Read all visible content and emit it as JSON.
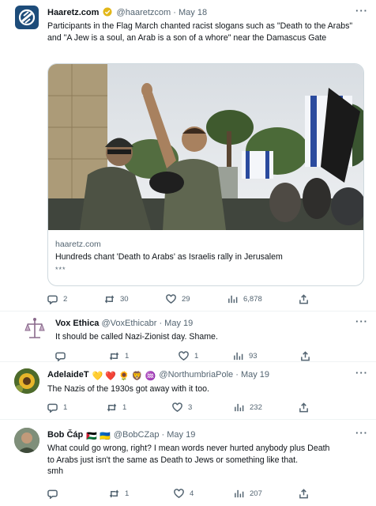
{
  "colors": {
    "text": "#0f1419",
    "muted": "#536471",
    "border": "#cfd9de",
    "verified": "#e2b719",
    "brand": "#1d4c7a"
  },
  "tweets": [
    {
      "name": "Haaretz.com",
      "handle": "@haaretzcom",
      "sep": "·",
      "date": "May 18",
      "text": "Participants in the Flag March chanted racist slogans such as \"Death to the Arabs\" and \"A Jew is a soul, an Arab is a son of a whore\" near the Damascus Gate",
      "card": {
        "domain": "haaretz.com",
        "title": "Hundreds chant 'Death to Arabs' as Israelis rally in Jerusalem",
        "desc": "***",
        "image_icon": "news-photo-flag-march"
      },
      "actions": {
        "replies": "2",
        "retweets": "30",
        "likes": "29",
        "views": "6,878"
      }
    },
    {
      "name": "Vox Ethica",
      "handle": "@VoxEthicabr",
      "sep": "·",
      "date": "May 19",
      "text": "It should be called Nazi-Zionist day. Shame.",
      "actions": {
        "replies": "",
        "retweets": "1",
        "likes": "1",
        "views": "93"
      }
    },
    {
      "name": "AdelaideT",
      "name_emojis": "💛 ❤️ 🌻 🦁 ♒",
      "handle": "@NorthumbriaPole",
      "sep": "·",
      "date": "May 19",
      "text": "The Nazis of the 1930s got away with it too.",
      "actions": {
        "replies": "1",
        "retweets": "1",
        "likes": "3",
        "views": "232"
      }
    },
    {
      "name": "Bob Čáp",
      "name_emojis": "🇵🇸 🇺🇦",
      "handle": "@BobCZap",
      "sep": "·",
      "date": "May 19",
      "text_lines": [
        "What could go wrong, right? I mean words never hurted anybody plus Death",
        "to Arabs just isn't the same as Death to Jews or something like that.",
        "smh"
      ],
      "actions": {
        "replies": "",
        "retweets": "1",
        "likes": "4",
        "views": "207"
      }
    }
  ],
  "icons": {
    "reply": "reply-icon",
    "retweet": "retweet-icon",
    "like": "heart-icon",
    "views": "views-icon",
    "share": "share-icon",
    "more": "more-icon"
  },
  "more_label": "···"
}
